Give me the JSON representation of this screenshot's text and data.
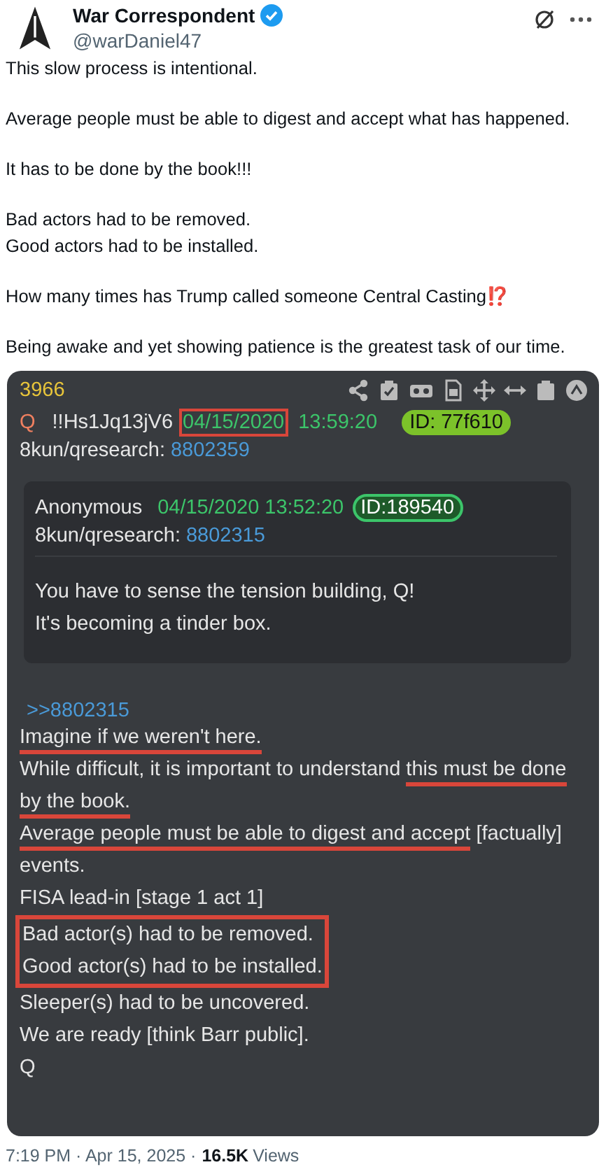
{
  "author": {
    "name": "War Correspondent",
    "handle": "@warDaniel47",
    "verified": true
  },
  "tweet_lines": [
    "This slow process is intentional.",
    "Average people must be able to digest and accept what has happened.",
    "It has to be done by the book!!!",
    "Bad actors had to be removed.\nGood actors had to be installed.",
    "How many times has Trump called someone Central Casting⁉️",
    "Being awake and yet showing patience is the greatest task of our time."
  ],
  "post": {
    "number": "3966",
    "author": "Q",
    "tripcode": "!!Hs1Jq13jV6",
    "date": "04/15/2020",
    "date_highlighted": true,
    "time": "13:59:20",
    "id": "ID: 77f610",
    "board": "8kun/qresearch:",
    "post_link": "8802359",
    "quote": {
      "author": "Anonymous",
      "datetime": "04/15/2020 13:52:20",
      "id": "ID:189540",
      "board": "8kun/qresearch:",
      "post_link": "8802315",
      "lines": [
        "You have to sense the tension building, Q!",
        "It's becoming a tinder box."
      ]
    },
    "reply_link": ">>8802315",
    "blocks": [
      {
        "kind": "line",
        "segments": [
          {
            "text": "Imagine if we weren't here.",
            "underlined": true
          }
        ]
      },
      {
        "kind": "line",
        "segments": [
          {
            "text": "While difficult, it is important to understand ",
            "underlined": false
          },
          {
            "text": "this must be done by the book.",
            "underlined": true
          }
        ]
      },
      {
        "kind": "line",
        "segments": [
          {
            "text": "Average people must be able to digest and accept",
            "underlined": true
          },
          {
            "text": " [factually] events.",
            "underlined": false
          }
        ]
      },
      {
        "kind": "line",
        "segments": [
          {
            "text": "FISA lead-in [stage 1 act 1]"
          }
        ]
      },
      {
        "kind": "boxed",
        "lines": [
          "Bad actor(s) had to be removed.",
          "Good actor(s) had to be installed."
        ]
      },
      {
        "kind": "line",
        "segments": [
          {
            "text": "Sleeper(s) had to be uncovered."
          }
        ]
      },
      {
        "kind": "line",
        "segments": [
          {
            "text": "We are ready [think Barr public]."
          }
        ]
      },
      {
        "kind": "line",
        "segments": [
          {
            "text": "Q"
          }
        ]
      }
    ]
  },
  "footer": {
    "time": "7:19 PM · Apr 15, 2025 ·",
    "views_count": "16.5K",
    "views_label": "Views"
  }
}
